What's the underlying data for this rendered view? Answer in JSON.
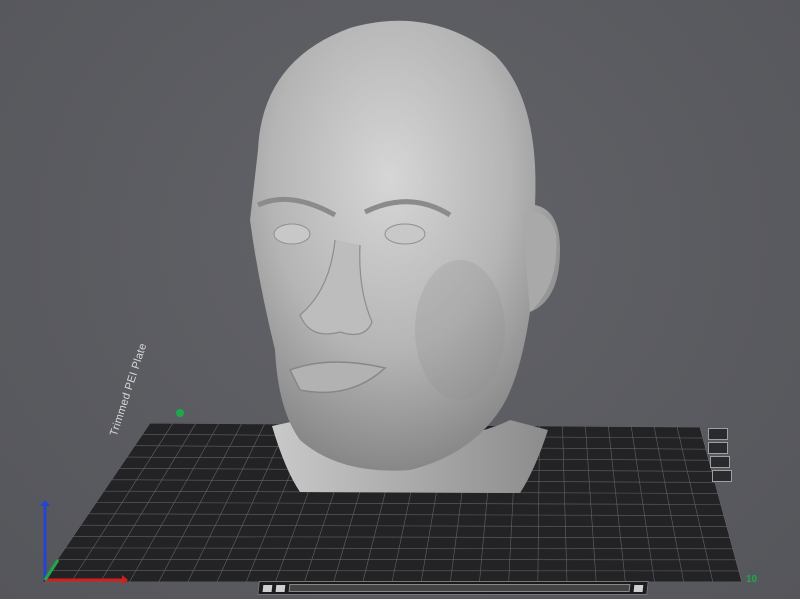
{
  "scene": {
    "object": "human head sculpture",
    "plate_label": "Trimmed PEI Plate",
    "axis_number": "10"
  },
  "colors": {
    "background": "#5b5c61",
    "plate": "#232325",
    "grid": "#6d6e73",
    "model": "#b8b8b8",
    "x_axis": "#d01f1f",
    "y_axis": "#1ea84a",
    "z_axis": "#2545d0"
  },
  "toolbar": {
    "icons": [
      "camera-icon",
      "settings-icon",
      "view-icon"
    ]
  }
}
